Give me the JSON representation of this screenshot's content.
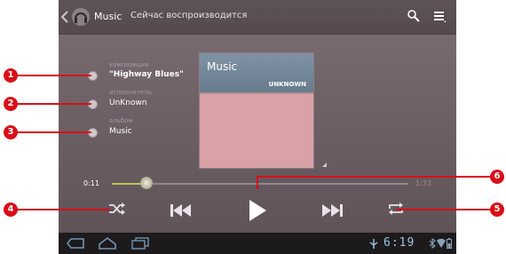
{
  "actionbar": {
    "app_title": "Music",
    "subtitle": "Сейчас воспроизводится",
    "icons": [
      "up-arrow-icon",
      "headphones-icon",
      "search-icon",
      "menu-icon"
    ]
  },
  "track_info": {
    "composition_label": "композиция",
    "composition_value": "\"Highway Blues\"",
    "artist_label": "исполнитель",
    "artist_value": "UnKnown",
    "album_label": "альбом",
    "album_value": "Music"
  },
  "album_art": {
    "name": "Music",
    "artist": "UNKNOWN"
  },
  "seek": {
    "elapsed": "0:11",
    "total": "1:33",
    "progress_fraction": 0.12
  },
  "controls": [
    "shuffle-icon",
    "previous-icon",
    "play-icon",
    "next-icon",
    "repeat-icon"
  ],
  "system_bar": {
    "time": "6:19",
    "icons": [
      "back-icon",
      "home-icon",
      "recent-apps-icon",
      "usb-icon",
      "bluetooth-icon",
      "wifi-icon",
      "battery-icon"
    ]
  },
  "callouts": [
    "1",
    "2",
    "3",
    "4",
    "5",
    "6"
  ],
  "colors": {
    "accent_seek": "#b7c84f",
    "callout_red": "#d80f18",
    "clock_blue": "#9cc7e7"
  }
}
